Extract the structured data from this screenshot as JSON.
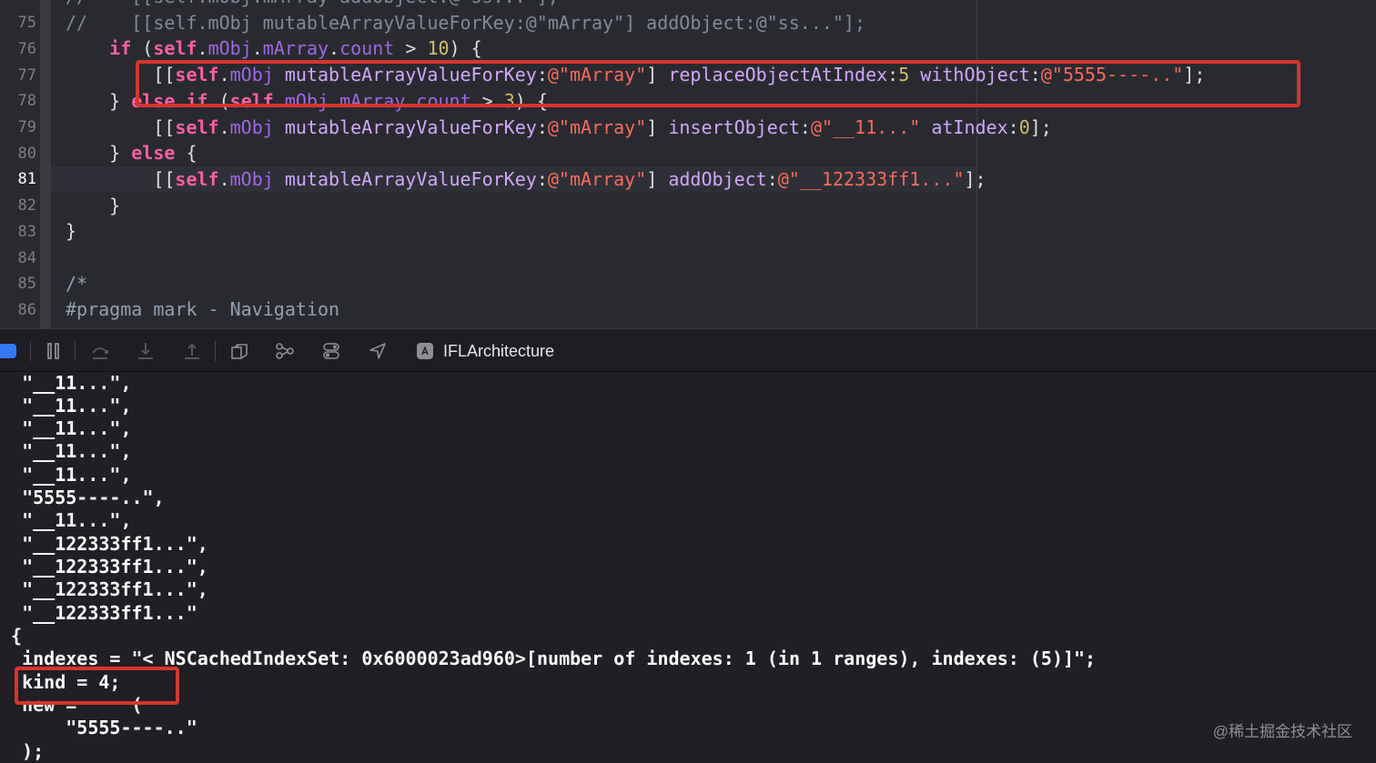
{
  "editor": {
    "line_numbers": [
      "75",
      "76",
      "77",
      "78",
      "79",
      "80",
      "81",
      "82",
      "83",
      "84",
      "85",
      "86"
    ],
    "current_line": "81",
    "top_partial_line": "//    [[self.mObj.mArray addObject:@\"ss...\"];",
    "line75": {
      "slashes": "//",
      "text": "    [[self.mObj mutableArrayValueForKey:@\"mArray\"] addObject:@\"ss...\"];"
    },
    "line76": {
      "indent": "    ",
      "kw_if": "if",
      "p1": " (",
      "self": "self",
      "dot1": ".",
      "mObj": "mObj",
      "dot2": ".",
      "mArray": "mArray",
      "dot3": ".",
      "count": "count",
      "gt": " > ",
      "num": "10",
      "end": ") {"
    },
    "line77": {
      "indent": "        ",
      "open": "[[",
      "self": "self",
      "dot": ".",
      "mObj": "mObj",
      "sp": " ",
      "method": "mutableArrayValueForKey",
      "colon1": ":",
      "str1": "@\"mArray\"",
      "close1": "] ",
      "m2": "replaceObjectAtIndex",
      "colon2": ":",
      "num": "5",
      "sp2": " ",
      "m3": "withObject",
      "colon3": ":",
      "str2": "@\"5555----..\"",
      "end": "];"
    },
    "line78": {
      "indent": "    ",
      "brace": "} ",
      "kw_else": "else",
      "sp": " ",
      "kw_if": "if",
      "p1": " (",
      "self": "self",
      "dot1": ".",
      "mObj": "mObj",
      "dot2": ".",
      "mArray": "mArray",
      "dot3": ".",
      "count": "count",
      "gt": " > ",
      "num": "3",
      "end": ") {"
    },
    "line79": {
      "indent": "        ",
      "open": "[[",
      "self": "self",
      "dot": ".",
      "mObj": "mObj",
      "sp": " ",
      "method": "mutableArrayValueForKey",
      "colon1": ":",
      "str1": "@\"mArray\"",
      "close1": "] ",
      "m2": "insertObject",
      "colon2": ":",
      "str2": "@\"__11...\"",
      "sp2": " ",
      "m3": "atIndex",
      "colon3": ":",
      "num": "0",
      "end": "];"
    },
    "line80": {
      "indent": "    ",
      "brace": "} ",
      "kw_else": "else",
      "end": " {"
    },
    "line81": {
      "indent": "        ",
      "open": "[[",
      "self": "self",
      "dot": ".",
      "mObj": "mObj",
      "sp": " ",
      "method": "mutableArrayValueForKey",
      "colon1": ":",
      "str1": "@\"mArray\"",
      "close1": "] ",
      "m2": "addObject",
      "colon2": ":",
      "str2": "@\"__122333ff1...\"",
      "end": "];"
    },
    "line82": "    }",
    "line83": "}",
    "line84": "",
    "line85": "/*",
    "line86": "#pragma mark - Navigation"
  },
  "toolbar": {
    "icons": [
      "pause-icon",
      "step-over-icon",
      "step-into-icon",
      "step-out-icon",
      "view-hierarchy-icon",
      "memory-graph-icon",
      "environment-overrides-icon",
      "location-icon"
    ],
    "target_name": "IFLArchitecture"
  },
  "console": {
    "lines": [
      "  \"__11...\",",
      "  \"__11...\",",
      "  \"__11...\",",
      "  \"__11...\",",
      "  \"__11...\",",
      "  \"5555----..\",",
      "  \"__11...\",",
      "  \"__122333ff1...\",",
      "  \"__122333ff1...\",",
      "  \"__122333ff1...\",",
      "  \"__122333ff1...\"",
      " {",
      "  indexes = \"< NSCachedIndexSet: 0x6000023ad960>[number of indexes: 1 (in 1 ranges), indexes: (5)]\";",
      "  kind = 4;",
      "  new =     (",
      "      \"5555----..\"",
      "  );"
    ]
  },
  "watermark": "@稀土掘金技术社区",
  "colors": {
    "highlight_box": "#d6362c",
    "breakpoint_toggle": "#3478f6",
    "keyword": "#fc5fa3",
    "string": "#fc6a5d",
    "number": "#d0bf69"
  }
}
